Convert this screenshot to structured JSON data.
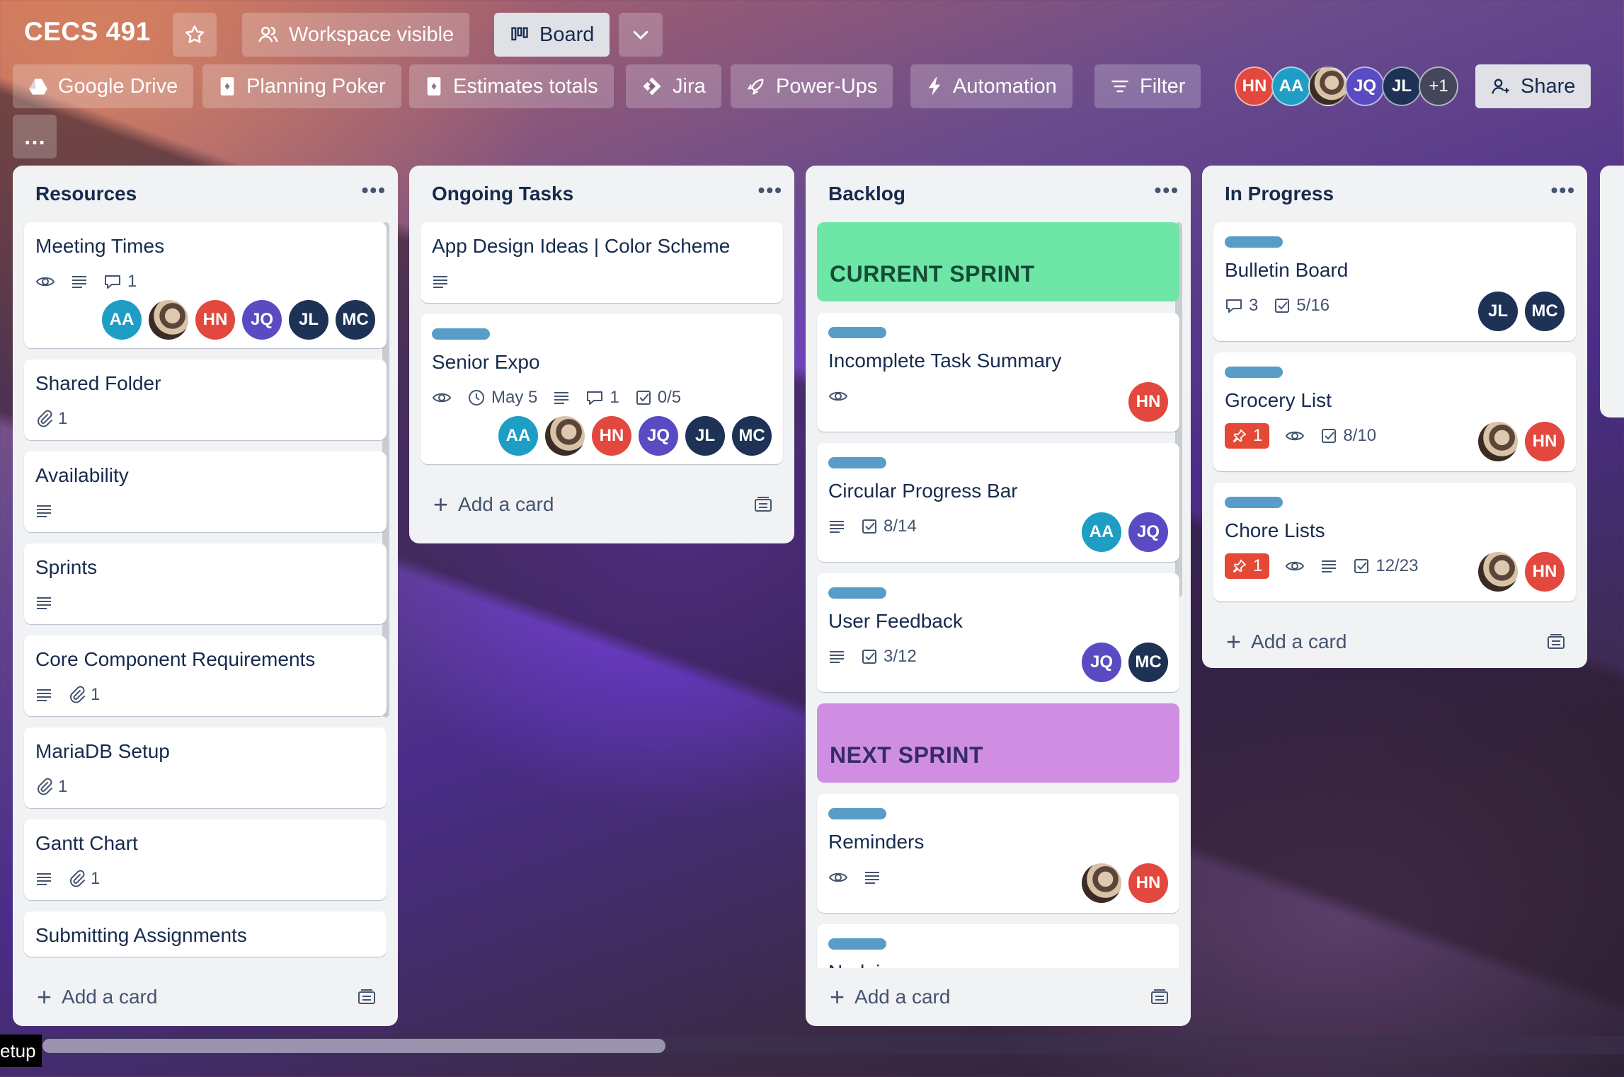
{
  "board": {
    "title": "CECS 491",
    "visibility_label": "Workspace visible",
    "view_label": "Board"
  },
  "toolbar": {
    "items": [
      "Google Drive",
      "Planning Poker",
      "Estimates totals",
      "Jira",
      "Power-Ups",
      "Automation"
    ],
    "filter_label": "Filter",
    "share_label": "Share",
    "extra_members": "+1",
    "more": "…"
  },
  "members": [
    {
      "initials": "HN",
      "color": "#e2483d"
    },
    {
      "initials": "AA",
      "color": "#1e9ec4"
    },
    {
      "initials": "",
      "color": "photo"
    },
    {
      "initials": "JQ",
      "color": "#5a4bc2"
    },
    {
      "initials": "JL",
      "color": "#1d3255"
    }
  ],
  "colors": {
    "label_blue": "#579dc8",
    "current_sprint": "#6de6a6",
    "next_sprint": "#d08ee3",
    "avatar_AA": "#1e9ec4",
    "avatar_HN": "#e2483d",
    "avatar_JQ": "#5a4bc2",
    "avatar_JL": "#1d3255",
    "avatar_MC": "#1d3255"
  },
  "lists": [
    {
      "title": "Resources",
      "add_label": "Add a card",
      "cards": [
        {
          "title": "Meeting Times",
          "comments": "1",
          "members": [
            "AA",
            "photo",
            "HN",
            "JQ",
            "JL",
            "MC"
          ]
        },
        {
          "title": "Shared Folder",
          "attachments": "1"
        },
        {
          "title": "Availability"
        },
        {
          "title": "Sprints"
        },
        {
          "title": "Core Component Requirements",
          "attachments": "1"
        },
        {
          "title": "MariaDB Setup",
          "attachments": "1"
        },
        {
          "title": "Gantt Chart",
          "attachments": "1"
        },
        {
          "title": "Submitting Assignments"
        }
      ]
    },
    {
      "title": "Ongoing Tasks",
      "add_label": "Add a card",
      "cards": [
        {
          "title": "App Design Ideas | Color Scheme"
        },
        {
          "title": "Senior Expo",
          "due": "May 5",
          "comments": "1",
          "checklist": "0/5",
          "members": [
            "AA",
            "photo",
            "HN",
            "JQ",
            "JL",
            "MC"
          ]
        }
      ]
    },
    {
      "title": "Backlog",
      "add_label": "Add a card",
      "cards": [
        {
          "title": "CURRENT SPRINT"
        },
        {
          "title": "Incomplete Task Summary",
          "members": [
            "HN"
          ]
        },
        {
          "title": "Circular Progress Bar",
          "checklist": "8/14",
          "members": [
            "AA",
            "JQ"
          ]
        },
        {
          "title": "User Feedback",
          "checklist": "3/12",
          "members": [
            "JQ",
            "MC"
          ]
        },
        {
          "title": "NEXT SPRINT"
        },
        {
          "title": "Reminders",
          "members": [
            "photo",
            "HN"
          ]
        },
        {
          "title": "Nudging"
        }
      ]
    },
    {
      "title": "In Progress",
      "add_label": "Add a card",
      "cards": [
        {
          "title": "Bulletin Board",
          "comments": "3",
          "checklist": "5/16",
          "members": [
            "JL",
            "MC"
          ]
        },
        {
          "title": "Grocery List",
          "pins": "1",
          "checklist": "8/10",
          "members": [
            "photo",
            "HN"
          ]
        },
        {
          "title": "Chore Lists",
          "pins": "1",
          "checklist": "12/23",
          "members": [
            "photo",
            "HN"
          ]
        }
      ]
    }
  ],
  "tooltip": "etup"
}
